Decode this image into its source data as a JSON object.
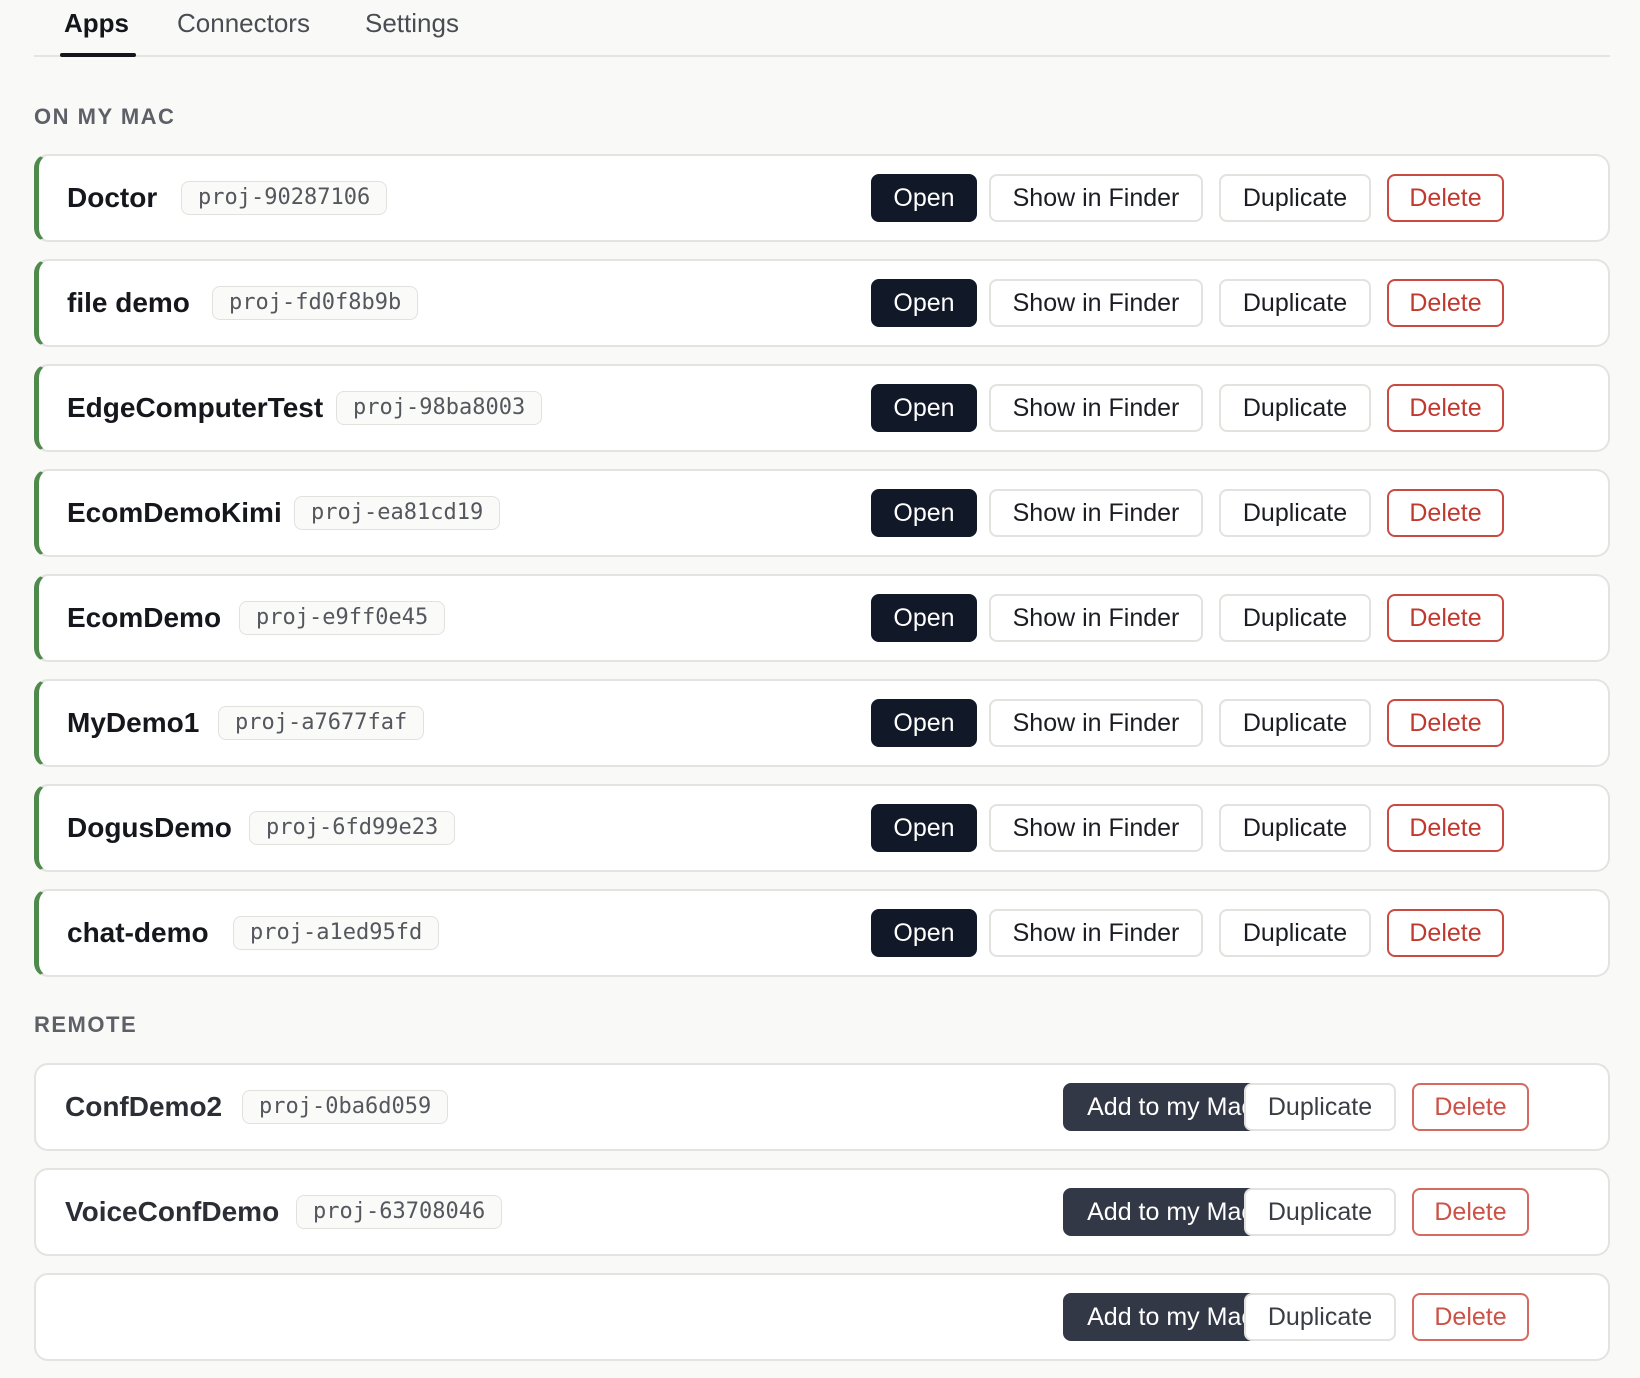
{
  "tabs": [
    {
      "label": "Apps",
      "active": true
    },
    {
      "label": "Connectors",
      "active": false
    },
    {
      "label": "Settings",
      "active": false
    }
  ],
  "sections": {
    "local": {
      "title": "ON MY MAC",
      "apps": [
        {
          "name": "Doctor",
          "id": "proj-90287106"
        },
        {
          "name": "file demo",
          "id": "proj-fd0f8b9b"
        },
        {
          "name": "EdgeComputerTest",
          "id": "proj-98ba8003"
        },
        {
          "name": "EcomDemoKimi",
          "id": "proj-ea81cd19"
        },
        {
          "name": "EcomDemo",
          "id": "proj-e9ff0e45"
        },
        {
          "name": "MyDemo1",
          "id": "proj-a7677faf"
        },
        {
          "name": "DogusDemo",
          "id": "proj-6fd99e23"
        },
        {
          "name": "chat-demo",
          "id": "proj-a1ed95fd"
        }
      ],
      "actions": {
        "open": "Open",
        "show_in_finder": "Show in Finder",
        "duplicate": "Duplicate",
        "delete": "Delete"
      }
    },
    "remote": {
      "title": "REMOTE",
      "apps": [
        {
          "name": "ConfDemo2",
          "id": "proj-0ba6d059"
        },
        {
          "name": "VoiceConfDemo",
          "id": "proj-63708046"
        },
        {
          "name": "",
          "id": ""
        }
      ],
      "actions": {
        "add_to_mac": "Add to my Mac",
        "duplicate": "Duplicate",
        "delete": "Delete"
      }
    }
  },
  "colors": {
    "accent_green": "#4f8a4d",
    "primary_button": "#111827",
    "secondary_dark_button": "#333846",
    "danger": "#c0392f"
  }
}
